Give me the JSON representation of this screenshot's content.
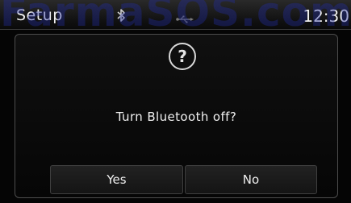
{
  "status_bar": {
    "title": "Setup",
    "time": "12:30",
    "icons": [
      "bluetooth-icon",
      "usb-icon"
    ]
  },
  "watermark": "FarmaSOS.com",
  "dialog": {
    "icon": "question-icon",
    "icon_glyph": "?",
    "message": "Turn Bluetooth off?",
    "buttons": {
      "yes": "Yes",
      "no": "No"
    }
  },
  "colors": {
    "background": "#050505",
    "text": "#f0f0f0",
    "border": "#4d4d4d",
    "watermark": "#232da0"
  }
}
